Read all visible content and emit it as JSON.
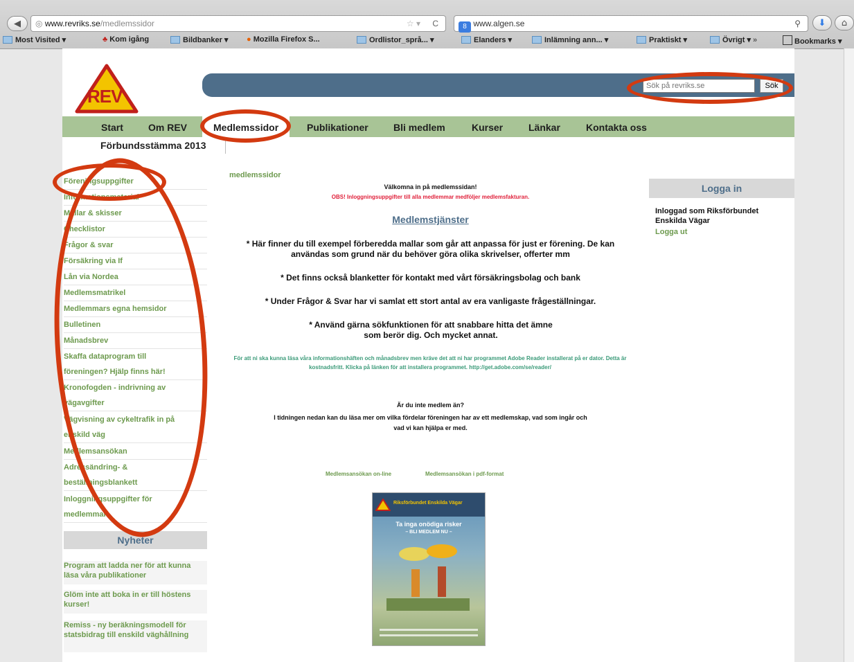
{
  "browser": {
    "url_domain": "www.revriks.se",
    "url_path": "/medlemssidor",
    "search_engine_text": "www.algen.se",
    "bookmarks": [
      "Most Visited",
      "Kom igång",
      "Bildbanker",
      "Mozilla Firefox S...",
      "Ordlistor_språ...",
      "Elanders",
      "Inlämning ann...",
      "Praktiskt",
      "Övrigt",
      "Bookmarks"
    ]
  },
  "site": {
    "logo": "REV",
    "search_placeholder": "Sök på revriks.se",
    "search_button": "Sök",
    "nav": [
      "Start",
      "Om REV",
      "Medlemssidor",
      "Publikationer",
      "Bli medlem",
      "Kurser",
      "Länkar",
      "Kontakta oss"
    ],
    "subnav": "Förbundsstämma 2013"
  },
  "sidebar": {
    "items": [
      "Föreningsuppgifter",
      "Informationsmaterial",
      "Mallar & skisser",
      "Checklistor",
      "Frågor & svar",
      "Försäkring via If",
      "Lån via Nordea",
      "Medlemsmatrikel",
      "Medlemmars egna hemsidor",
      "Bulletinen",
      "Månadsbrev",
      "Skaffa dataprogram till",
      "föreningen? Hjälp finns här!",
      "Kronofogden - indrivning av",
      "vägavgifter",
      "Vägvisning av cykeltrafik in på",
      "enskild väg",
      "Medlemsansökan",
      "Adressändring- &",
      "beställningsblankett",
      "Inloggningsuppgifter för",
      "medlemmar"
    ]
  },
  "news": {
    "title": "Nyheter",
    "items": [
      "Program att ladda ner för att kunna läsa våra publikationer",
      "Glöm inte att boka in er till höstens kurser!",
      "Remiss - ny beräkningsmodell för statsbidrag till enskild väghållning"
    ]
  },
  "main": {
    "section_label": "medlemssidor",
    "welcome": "Välkomna in på medlemssidan!",
    "obs": "OBS! Inloggningsuppgifter till alla medlemmar medföljer medlemsfakturan.",
    "heading": "Medlemstjänster",
    "p1": "* Här finner du till exempel förberedda mallar som går att anpassa för just er förening. De kan användas som grund när du behöver göra olika skrivelser, offerter mm",
    "p2": "* Det finns också blanketter för kontakt med vårt försäkringsbolag och bank",
    "p3": "* Under Frågor & Svar har vi samlat ett stort antal av era vanligaste frågeställningar.",
    "p4": "* Använd gärna sökfunktionen för att snabbare hitta det ämne som berör dig. Och mycket annat.",
    "adobe": "För att ni ska kunna läsa våra informationshäften och månadsbrev men kräve det att ni har programmet Adobe Reader installerat på er dator. Detta är kostnadsfritt. Klicka på länken för att installera programmet. http://get.adobe.com/se/reader/",
    "not_member": "Är du inte medlem än?",
    "member_text": "I tidningen nedan kan du läsa mer om vilka fördelar föreningen har av ett medlemskap, vad som ingår och vad vi kan hjälpa er med.",
    "link_online": "Medlemsansökan on-line",
    "link_pdf": "Medlemsansökan i pdf-format",
    "brochure_org": "Riksförbundet Enskilda Vägar",
    "brochure_title": "Ta inga onödiga risker",
    "brochure_sub": "– BLI MEDLEM NU –"
  },
  "login": {
    "title": "Logga in",
    "status": "Inloggad som Riksförbundet Enskilda Vägar",
    "logout": "Logga ut"
  },
  "colors": {
    "annotation": "#d33a10",
    "nav_green": "#a8c496",
    "link_green": "#6d9a4e"
  }
}
